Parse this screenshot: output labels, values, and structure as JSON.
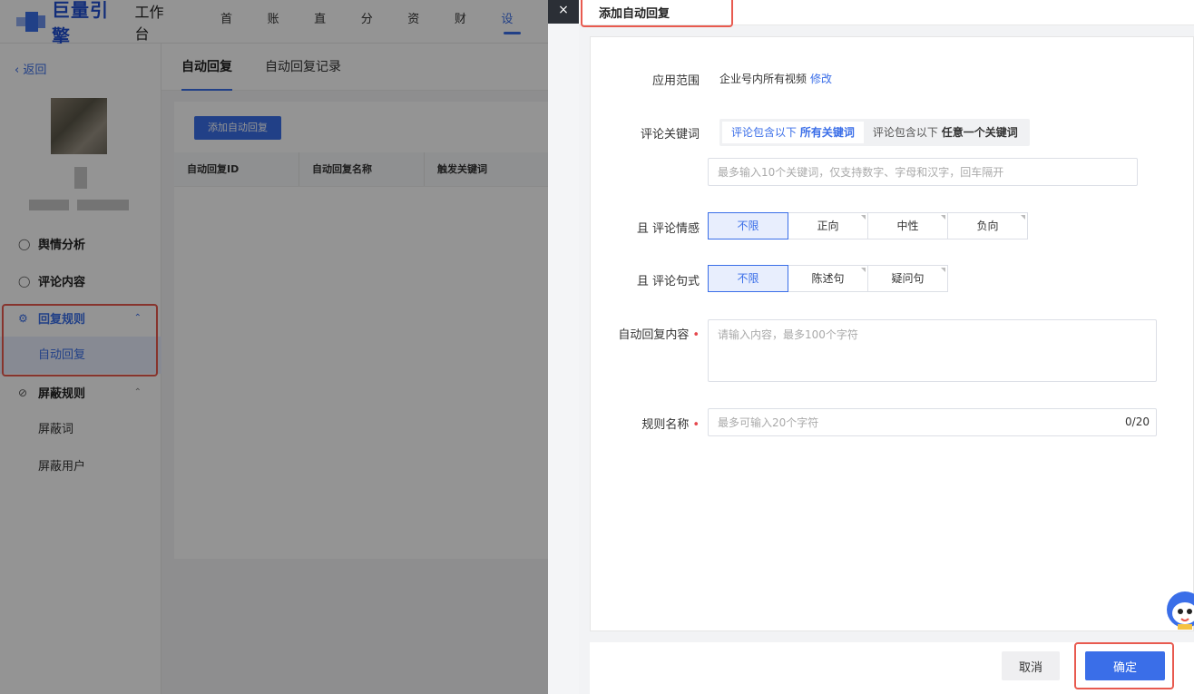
{
  "header": {
    "logo_text": "巨量引擎",
    "logo_sub": "工作台",
    "nav": [
      {
        "label": "首页"
      },
      {
        "label": "账户"
      },
      {
        "label": "直播"
      },
      {
        "label": "分析"
      },
      {
        "label": "资产"
      },
      {
        "label": "财务"
      },
      {
        "label": "设置",
        "active": true
      }
    ]
  },
  "sidebar": {
    "back_label": "返回",
    "menu": {
      "sentiment": "舆情分析",
      "comments": "评论内容",
      "reply_rules": "回复规则",
      "auto_reply": "自动回复",
      "block_rules": "屏蔽规则",
      "block_words": "屏蔽词",
      "block_users": "屏蔽用户"
    }
  },
  "content": {
    "tabs": [
      "自动回复",
      "自动回复记录"
    ],
    "add_button": "添加自动回复",
    "table_headers": [
      "自动回复ID",
      "自动回复名称",
      "触发关键词"
    ]
  },
  "drawer": {
    "close": "×",
    "title": "添加自动回复",
    "scope": {
      "label": "应用范围",
      "value": "企业号内所有视频",
      "link": "修改"
    },
    "keywords": {
      "label": "评论关键词",
      "option1_prefix": "评论包含以下",
      "option1_bold": "所有关键词",
      "option2_prefix": "评论包含以下",
      "option2_bold": "任意一个关键词",
      "placeholder": "最多输入10个关键词，仅支持数字、字母和汉字，回车隔开"
    },
    "sentiment": {
      "label": "且 评论情感",
      "options": [
        "不限",
        "正向",
        "中性",
        "负向"
      ],
      "selected": "不限"
    },
    "sentence": {
      "label": "且 评论句式",
      "options": [
        "不限",
        "陈述句",
        "疑问句"
      ],
      "selected": "不限"
    },
    "reply_content": {
      "label": "自动回复内容",
      "required_mark": "•",
      "placeholder": "请输入内容，最多100个字符"
    },
    "rule_name": {
      "label": "规则名称",
      "required_mark": "•",
      "placeholder": "最多可输入20个字符",
      "counter": "0/20"
    },
    "footer": {
      "cancel": "取消",
      "confirm": "确定"
    }
  },
  "colors": {
    "accent": "#3a6ee8",
    "highlight": "#e85a4f"
  }
}
